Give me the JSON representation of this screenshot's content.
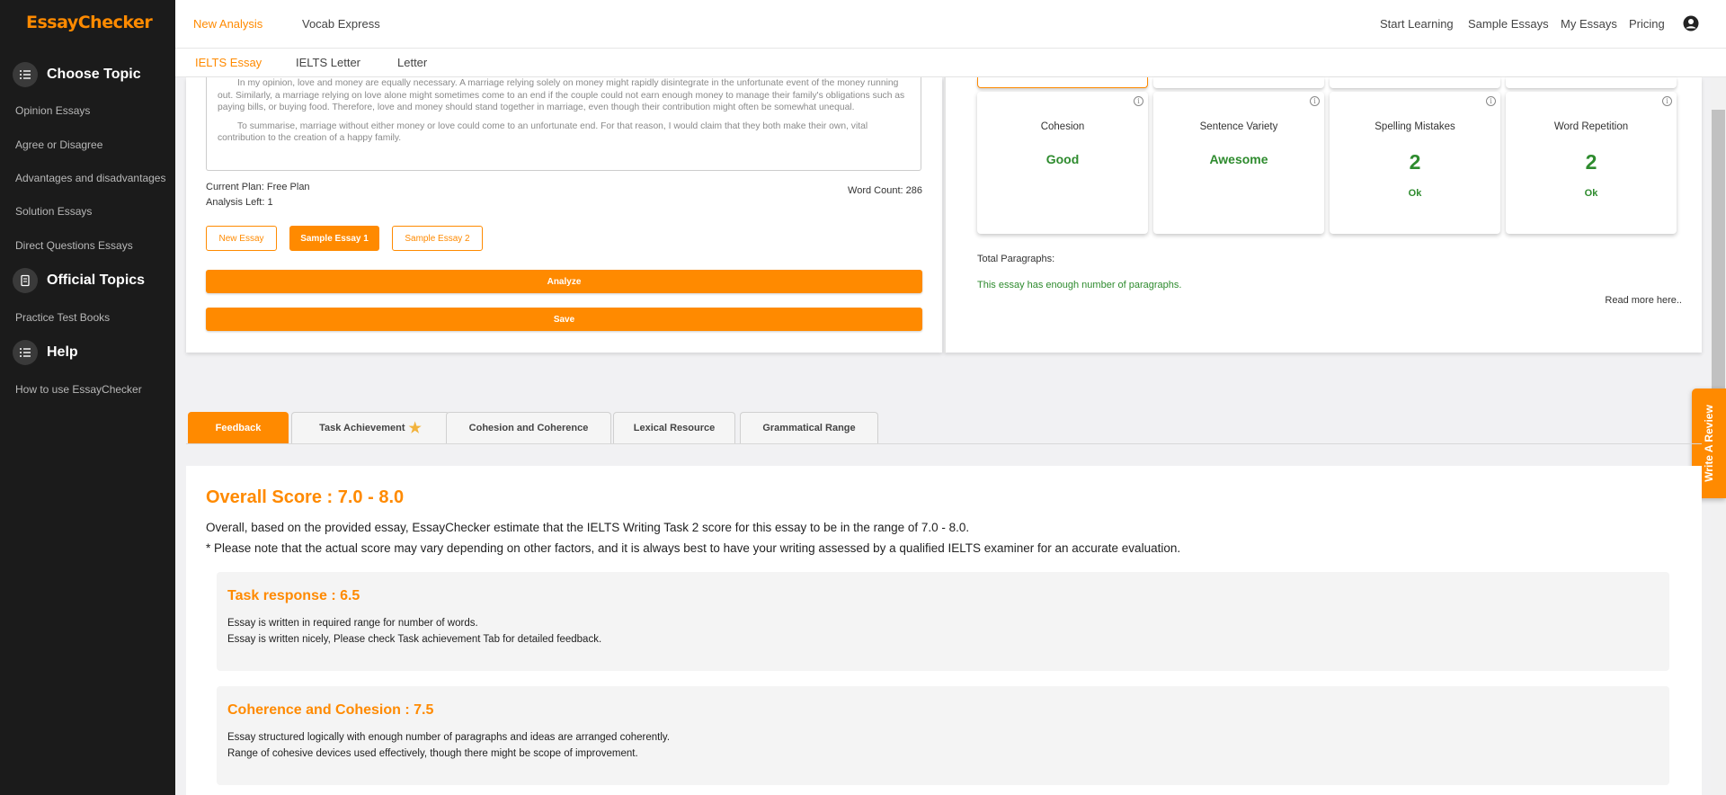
{
  "sidebar": {
    "logo": "EssayChecker",
    "sections": [
      {
        "title": "Choose Topic",
        "icon": "list-icon"
      },
      {
        "title": "Official Topics",
        "icon": "book-icon"
      },
      {
        "title": "Help",
        "icon": "list-icon"
      }
    ],
    "choose_topic_links": [
      "Opinion Essays",
      "Agree or Disagree",
      "Advantages and disadvantages",
      "Solution Essays",
      "Direct Questions Essays"
    ],
    "official_links": [
      "Practice Test Books"
    ],
    "help_links": [
      "How to use EssayChecker"
    ]
  },
  "topnav": {
    "left": [
      "New Analysis",
      "Vocab Express"
    ],
    "right": [
      "Start Learning",
      "Sample Essays",
      "My Essays",
      "Pricing"
    ],
    "user_icon": "user-circle-icon"
  },
  "subnav": [
    "IELTS Essay",
    "IELTS Letter",
    "Letter"
  ],
  "editor": {
    "paragraph_1": "In my opinion, love and money are equally necessary. A marriage relying solely on money might rapidly disintegrate in the unfortunate event of the money running out. Similarly, a marriage relying on love alone might sometimes come to an end if the couple could not earn enough money to manage their family's obligations such as paying bills, or buying food. Therefore, love and money should stand together in marriage, even though their contribution might often be somewhat unequal.",
    "paragraph_2": "To summarise, marriage without either money or love could come to an unfortunate end. For that reason, I would claim that they both make their own, vital contribution to the creation of a happy family.",
    "current_plan": "Current Plan: Free Plan",
    "analysis_left": "Analysis Left: 1",
    "word_count": "Word Count: 286",
    "buttons": {
      "new_essay": "New Essay",
      "sample_1": "Sample Essay 1",
      "sample_2": "Sample Essay 2"
    },
    "analyze": "Analyze",
    "save": "Save"
  },
  "stats": {
    "cards": [
      {
        "title": "Cohesion",
        "value": "Good"
      },
      {
        "title": "Sentence Variety",
        "value": "Awesome"
      },
      {
        "title": "Spelling Mistakes",
        "value": "2",
        "status": "Ok"
      },
      {
        "title": "Word Repetition",
        "value": "2",
        "status": "Ok"
      }
    ],
    "total_paragraphs_label": "Total Paragraphs:",
    "paragraphs_message": "This essay has enough number of paragraphs.",
    "read_more": "Read more here..",
    "colors": {
      "good": "#2e8b2e"
    }
  },
  "review_tab": "Write A Review",
  "tabs": [
    {
      "label": "Feedback"
    },
    {
      "label": "Task Achievement",
      "icon": "star-icon"
    },
    {
      "label": "Cohesion and Coherence"
    },
    {
      "label": "Lexical Resource"
    },
    {
      "label": "Grammatical Range"
    }
  ],
  "feedback": {
    "overall_title": "Overall Score : 7.0 - 8.0",
    "overall_line_1": "Overall, based on the provided essay, EssayChecker estimate that the IELTS Writing Task 2 score for this essay to be in the range of 7.0 - 8.0.",
    "overall_line_2": "* Please note that the actual score may vary depending on other factors, and it is always best to have your writing assessed by a qualified IELTS examiner for an accurate evaluation.",
    "sections": [
      {
        "title": "Task response : 6.5",
        "lines": [
          "Essay is written in required range for number of words.",
          "Essay is written nicely, Please check Task achievement Tab for detailed feedback."
        ]
      },
      {
        "title": "Coherence and Cohesion : 7.5",
        "lines": [
          "Essay structured logically with enough number of paragraphs and ideas are arranged coherently.",
          "Range of cohesive devices used effectively, though there might be scope of improvement."
        ]
      }
    ]
  },
  "theme": {
    "accent": "#ff8a00",
    "sidebar_bg": "#1b1b1b"
  }
}
